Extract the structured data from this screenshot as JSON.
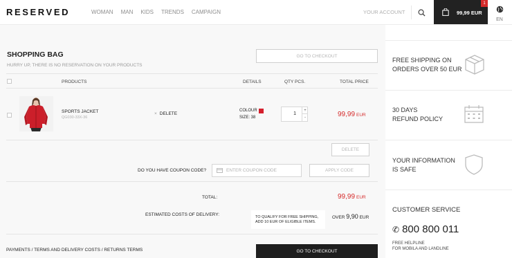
{
  "header": {
    "logo": "RESERVED",
    "nav": [
      "WOMAN",
      "MAN",
      "KIDS",
      "TRENDS",
      "CAMPAIGN"
    ],
    "account_label": "YOUR ACCOUNT",
    "cart_amount": "99,99 EUR",
    "cart_count": "1",
    "language": "EN"
  },
  "bag": {
    "title": "SHOPPING BAG",
    "subtitle": "HURRY UP, THERE IS NO RESERVATION ON YOUR PRODUCTS",
    "checkout_top": "GO TO CHECKOUT",
    "columns": {
      "products": "PRODUCTS",
      "details": "DETAILS",
      "qty": "QTY PCS.",
      "total": "TOTAL PRICE"
    },
    "item": {
      "name": "SPORTS JACKET",
      "code": "QG030-33X-36",
      "delete_label": "DELETE",
      "colour_label": "COLOUR",
      "colour_hex": "#d51f2c",
      "size_label": "SIZE: 38",
      "qty": "1",
      "price": "99,99",
      "currency": "EUR"
    },
    "delete_button": "DELETE",
    "coupon_question": "DO YOU HAVE COUPON CODE?",
    "coupon_placeholder": "ENTER COUPON CODE",
    "apply_button": "APPLY CODE",
    "total_label": "TOTAL:",
    "total_value": "99,99",
    "total_currency": "EUR",
    "delivery_label": "ESTIMATED COSTS OF DELIVERY:",
    "delivery_note_line1": "TO QUALIFY FOR FREE SHIPPING,",
    "delivery_note_line2": "ADD 10 EUR OF ELIGIBLE ITEMS.",
    "delivery_over": "OVER",
    "delivery_value": "9,90",
    "delivery_currency": "EUR",
    "footer_links": "PAYMENTS / TERMS AND DELIVERY COSTS / RETURNS TERMS",
    "checkout_bottom": "GO TO CHECKOUT"
  },
  "sidebar": {
    "shipping_line1": "FREE SHIPPING ON",
    "shipping_line2": "ORDERS OVER 50 EUR",
    "refund_line1": "30 DAYS",
    "refund_line2": "REFUND POLICY",
    "info_line1": "YOUR INFORMATION",
    "info_line2": "IS SAFE",
    "service_title": "CUSTOMER SERVICE",
    "phone": "800 800 011",
    "helpline_line1": "FREE HELPLINE",
    "helpline_line2": "FOR MOBILA AND LANDLINE"
  },
  "colors": {
    "accent": "#d52b2b",
    "dark": "#222222",
    "muted": "#b0b0b0"
  }
}
